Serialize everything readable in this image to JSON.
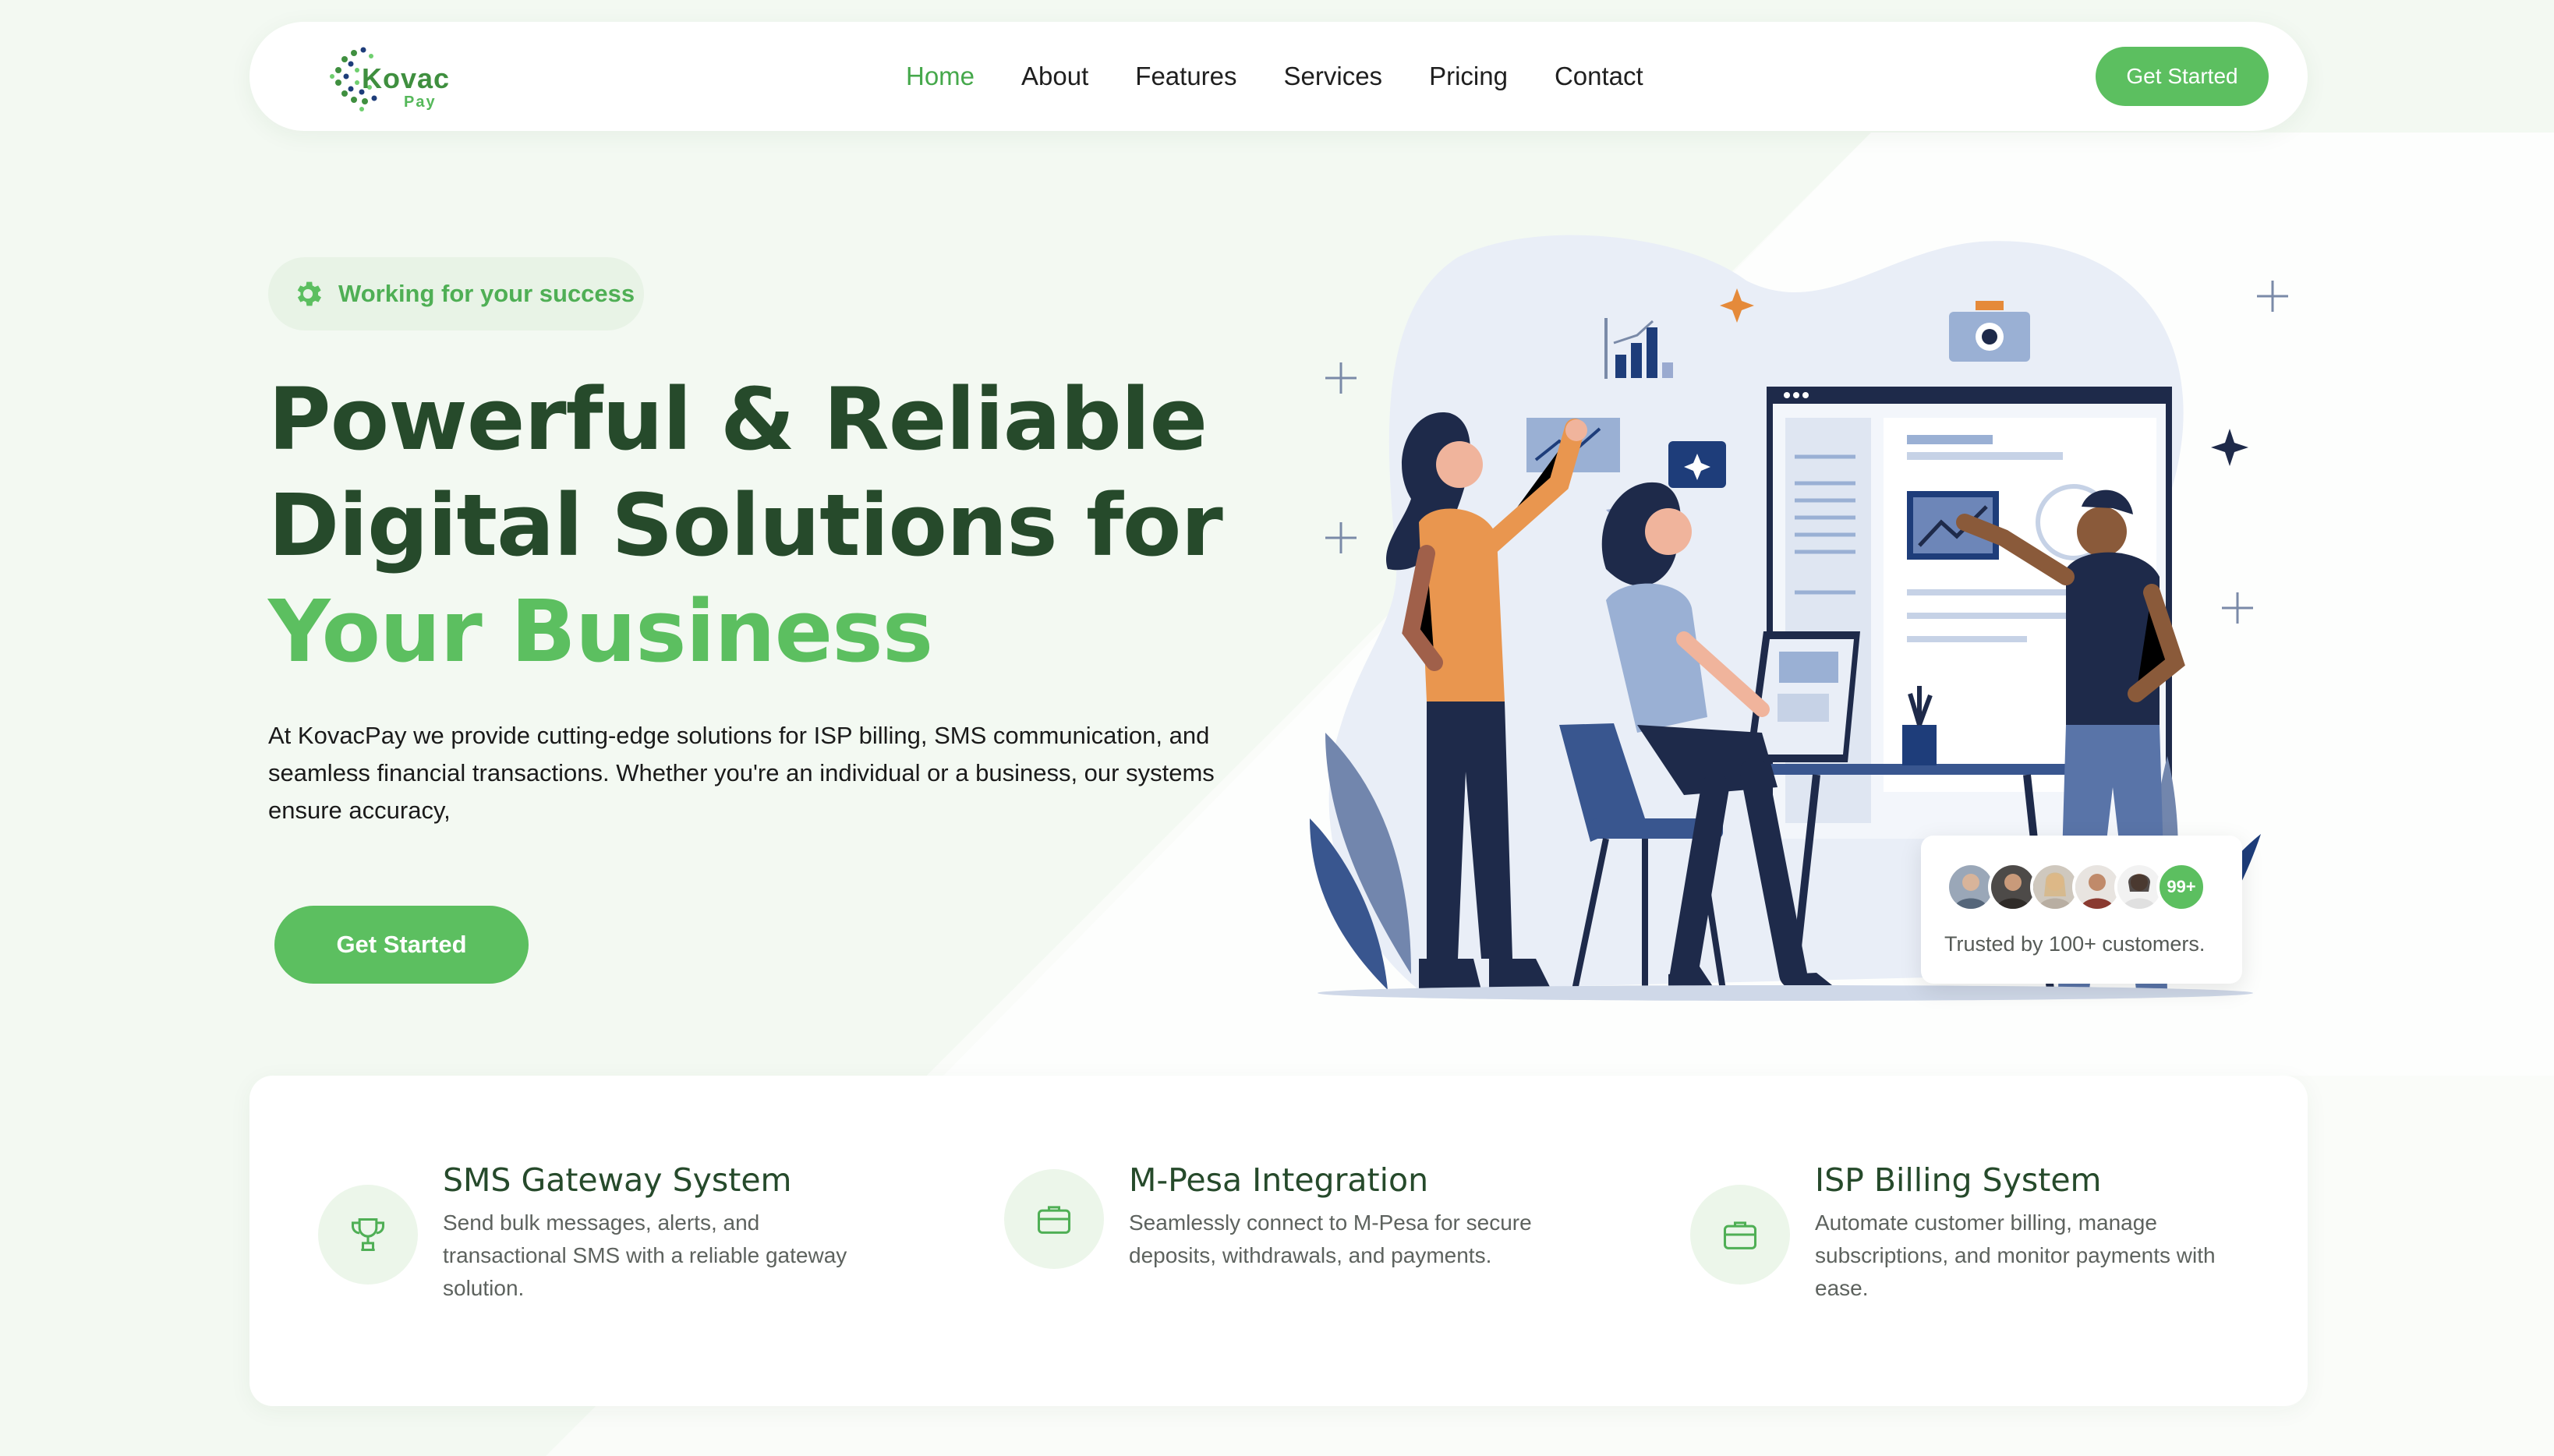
{
  "brand": {
    "name": "Kovac",
    "sub": "Pay"
  },
  "nav": {
    "items": [
      {
        "label": "Home",
        "active": true
      },
      {
        "label": "About"
      },
      {
        "label": "Features"
      },
      {
        "label": "Services"
      },
      {
        "label": "Pricing"
      },
      {
        "label": "Contact"
      }
    ],
    "cta_label": "Get Started"
  },
  "hero": {
    "badge": "Working for your success",
    "title_line1": "Powerful & Reliable",
    "title_line2": "Digital Solutions for",
    "title_highlight": "Your Business",
    "description": "At KovacPay we provide cutting-edge solutions for ISP billing, SMS communication, and seamless financial transactions. Whether you're an individual or a business, our systems ensure accuracy,",
    "cta_label": "Get Started"
  },
  "trust": {
    "more_badge": "99+",
    "text": "Trusted by 100+ customers."
  },
  "features": [
    {
      "icon": "trophy-icon",
      "title": "SMS Gateway System",
      "description": "Send bulk messages, alerts, and transactional SMS with a reliable gateway solution."
    },
    {
      "icon": "briefcase-icon",
      "title": "M-Pesa Integration",
      "description": "Seamlessly connect to M-Pesa for secure deposits, withdrawals, and payments."
    },
    {
      "icon": "briefcase-icon",
      "title": "ISP Billing System",
      "description": "Automate customer billing, manage subscriptions, and monitor payments with ease."
    }
  ],
  "colors": {
    "accent": "#5cbf60",
    "dark_green": "#264a2b",
    "background": "#f3f9f2",
    "navy": "#1e2a4a"
  }
}
